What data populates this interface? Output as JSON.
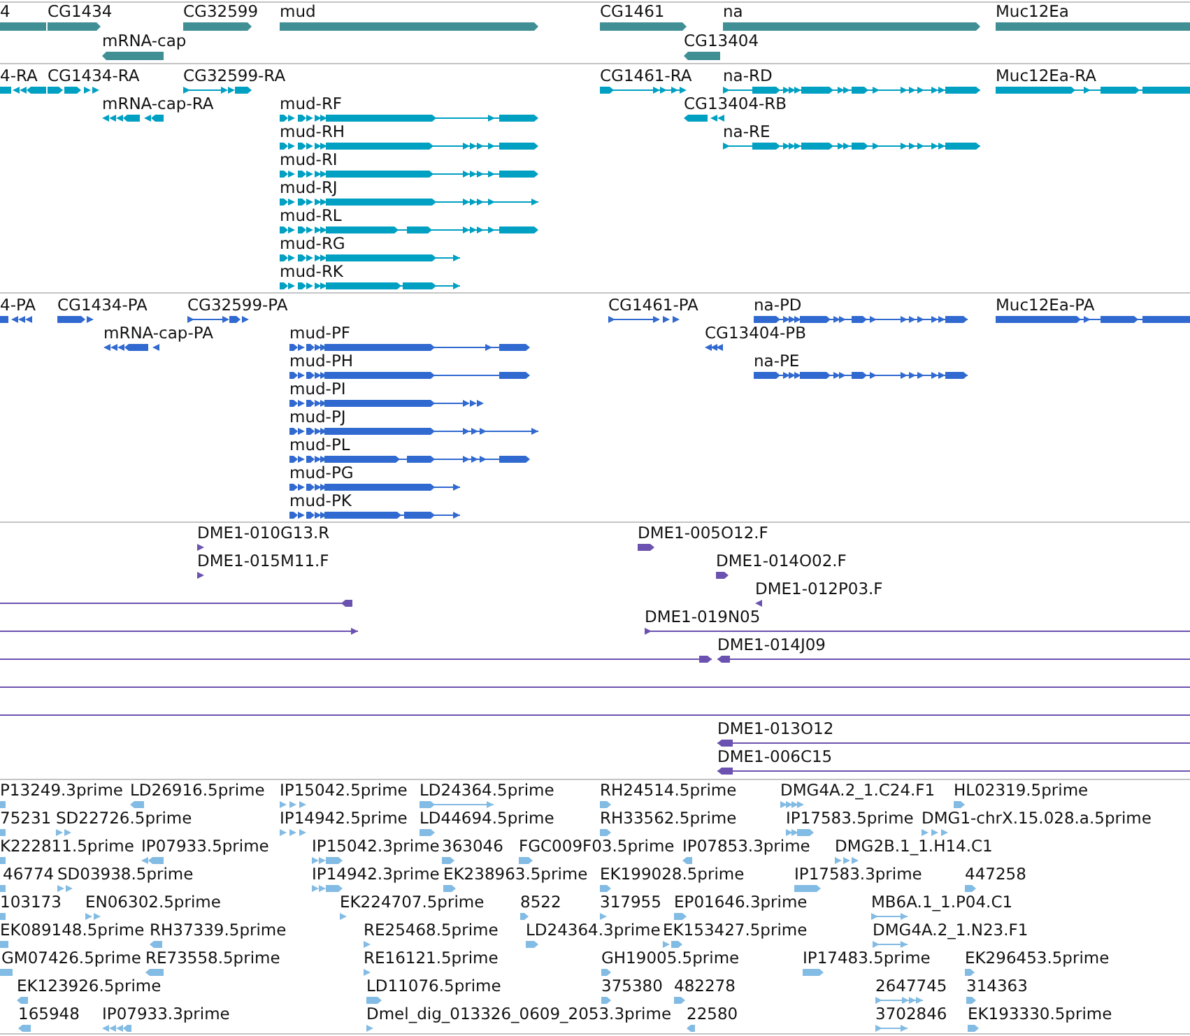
{
  "tracks": [
    {
      "kind": "gene",
      "color": "#3f8f95",
      "features": [
        {
          "label": "4",
          "reverse": true
        },
        {
          "label": "CG1434",
          "reverse": false
        },
        {
          "label": "CG32599",
          "reverse": false
        },
        {
          "label": "mud",
          "reverse": false
        },
        {
          "label": "CG1461",
          "reverse": false
        },
        {
          "label": "na",
          "reverse": false
        },
        {
          "label": "Muc12Ea",
          "reverse": false
        },
        {
          "label": "mRNA-cap",
          "reverse": true
        },
        {
          "label": "CG13404",
          "reverse": true
        }
      ]
    },
    {
      "kind": "transcript",
      "color": "#00a0c3",
      "features": [
        {
          "label": "4-RA",
          "reverse": true
        },
        {
          "label": "CG1434-RA",
          "reverse": false
        },
        {
          "label": "CG32599-RA",
          "reverse": false
        },
        {
          "label": "CG1461-RA",
          "reverse": false
        },
        {
          "label": "na-RD",
          "reverse": false
        },
        {
          "label": "Muc12Ea-RA",
          "reverse": false
        },
        {
          "label": "mRNA-cap-RA",
          "reverse": true
        },
        {
          "label": "mud-RF",
          "reverse": false
        },
        {
          "label": "CG13404-RB",
          "reverse": true
        },
        {
          "label": "mud-RH",
          "reverse": false
        },
        {
          "label": "na-RE",
          "reverse": false
        },
        {
          "label": "mud-RI",
          "reverse": false
        },
        {
          "label": "mud-RJ",
          "reverse": false
        },
        {
          "label": "mud-RL",
          "reverse": false
        },
        {
          "label": "mud-RG",
          "reverse": false
        },
        {
          "label": "mud-RK",
          "reverse": false
        }
      ]
    },
    {
      "kind": "protein",
      "color": "#3069d0",
      "features": [
        {
          "label": "4-PA",
          "reverse": true
        },
        {
          "label": "CG1434-PA",
          "reverse": false
        },
        {
          "label": "CG32599-PA",
          "reverse": false
        },
        {
          "label": "CG1461-PA",
          "reverse": false
        },
        {
          "label": "na-PD",
          "reverse": false
        },
        {
          "label": "Muc12Ea-PA",
          "reverse": false
        },
        {
          "label": "mRNA-cap-PA",
          "reverse": true
        },
        {
          "label": "mud-PF",
          "reverse": false
        },
        {
          "label": "CG13404-PB",
          "reverse": true
        },
        {
          "label": "mud-PH",
          "reverse": false
        },
        {
          "label": "na-PE",
          "reverse": false
        },
        {
          "label": "mud-PI",
          "reverse": false
        },
        {
          "label": "mud-PJ",
          "reverse": false
        },
        {
          "label": "mud-PL",
          "reverse": false
        },
        {
          "label": "mud-PG",
          "reverse": false
        },
        {
          "label": "mud-PK",
          "reverse": false
        }
      ]
    },
    {
      "kind": "clone",
      "color": "#6b52b0",
      "features": [
        {
          "kind": "read",
          "label": "DME1-010G13.R",
          "reverse": false
        },
        {
          "kind": "read",
          "label": "DME1-005O12.F",
          "reverse": false
        },
        {
          "kind": "read",
          "label": "DME1-015M11.F",
          "reverse": false
        },
        {
          "kind": "read",
          "label": "DME1-014O02.F",
          "reverse": false
        },
        {
          "kind": "read",
          "reverse": true
        },
        {
          "kind": "read",
          "label": "DME1-012P03.F",
          "reverse": true
        },
        {
          "kind": "read",
          "reverse": false
        },
        {
          "kind": "read",
          "label": "DME1-019N05",
          "reverse": false
        },
        {
          "kind": "read",
          "reverse": false
        },
        {
          "kind": "read",
          "label": "DME1-014J09",
          "reverse": true
        },
        {
          "kind": "span"
        },
        {
          "kind": "span"
        },
        {
          "kind": "read",
          "label": "DME1-013O12",
          "reverse": true
        },
        {
          "kind": "read",
          "label": "DME1-006C15",
          "reverse": true
        }
      ]
    },
    {
      "kind": "est",
      "color": "#82bbe3",
      "features": [
        {
          "label": "P13249.3prime",
          "reverse": true
        },
        {
          "label": "LD26916.5prime",
          "reverse": true
        },
        {
          "label": "IP15042.5prime",
          "reverse": false
        },
        {
          "label": "LD24364.5prime",
          "reverse": false
        },
        {
          "label": "RH24514.5prime",
          "reverse": false
        },
        {
          "label": "DMG4A.2_1.C24.F1",
          "reverse": false
        },
        {
          "label": "HL02319.5prime",
          "reverse": false
        },
        {
          "label": "75231",
          "reverse": true
        },
        {
          "label": "SD22726.5prime",
          "reverse": false
        },
        {
          "label": "IP14942.5prime",
          "reverse": false
        },
        {
          "label": "LD44694.5prime",
          "reverse": false
        },
        {
          "label": "RH33562.5prime",
          "reverse": false
        },
        {
          "label": "IP17583.5prime",
          "reverse": false
        },
        {
          "label": "DMG1-chrX.15.028.a.5prime",
          "reverse": false
        },
        {
          "label": "K222811.5prime",
          "reverse": true
        },
        {
          "label": "IP07933.5prime",
          "reverse": true
        },
        {
          "label": "IP15042.3prime",
          "reverse": false
        },
        {
          "label": "363046",
          "reverse": false
        },
        {
          "label": "FGC009F03.5prime",
          "reverse": false
        },
        {
          "label": "IP07853.3prime",
          "reverse": true
        },
        {
          "label": "DMG2B.1_1.H14.C1",
          "reverse": false
        },
        {
          "label": "46774",
          "reverse": true
        },
        {
          "label": "SD03938.5prime",
          "reverse": false
        },
        {
          "label": "IP14942.3prime",
          "reverse": false
        },
        {
          "label": "EK238963.5prime",
          "reverse": false
        },
        {
          "label": "EK199028.5prime",
          "reverse": false
        },
        {
          "label": "IP17583.3prime",
          "reverse": false
        },
        {
          "label": "447258",
          "reverse": false
        },
        {
          "label": "103173",
          "reverse": true
        },
        {
          "label": "EN06302.5prime",
          "reverse": false
        },
        {
          "label": "EK224707.5prime",
          "reverse": false
        },
        {
          "label": "8522",
          "reverse": false
        },
        {
          "label": "317955",
          "reverse": false
        },
        {
          "label": "EP01646.3prime",
          "reverse": false
        },
        {
          "label": "MB6A.1_1.P04.C1",
          "reverse": false
        },
        {
          "label": "EK089148.5prime",
          "reverse": true
        },
        {
          "label": "RH37339.5prime",
          "reverse": true
        },
        {
          "label": "RE25468.5prime",
          "reverse": false
        },
        {
          "label": "LD24364.3prime",
          "reverse": false
        },
        {
          "label": "EK153427.5prime",
          "reverse": false
        },
        {
          "label": "DMG4A.2_1.N23.F1",
          "reverse": false
        },
        {
          "label": "GM07426.5prime",
          "reverse": true
        },
        {
          "label": "RE73558.5prime",
          "reverse": true
        },
        {
          "label": "RE16121.5prime",
          "reverse": false
        },
        {
          "label": "GH19005.5prime",
          "reverse": false
        },
        {
          "label": "IP17483.5prime",
          "reverse": false
        },
        {
          "label": "EK296453.5prime",
          "reverse": false
        },
        {
          "label": "EK123926.5prime",
          "reverse": true
        },
        {
          "label": "LD11076.5prime",
          "reverse": false
        },
        {
          "label": "375380",
          "reverse": false
        },
        {
          "label": "482278",
          "reverse": false
        },
        {
          "label": "2647745",
          "reverse": false
        },
        {
          "label": "314363",
          "reverse": false
        },
        {
          "label": "165948",
          "reverse": true
        },
        {
          "label": "IP07933.3prime",
          "reverse": true
        },
        {
          "label": "Dmel_dig_013326_0609_2053.3prime",
          "reverse": false
        },
        {
          "label": "22580",
          "reverse": true
        },
        {
          "label": "3702846",
          "reverse": false
        },
        {
          "label": "EK193330.5prime",
          "reverse": false
        }
      ]
    }
  ]
}
